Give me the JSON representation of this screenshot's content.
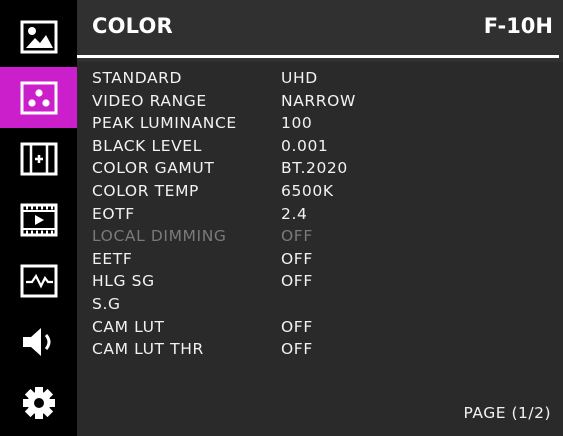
{
  "sidebar": {
    "items": [
      {
        "name": "picture",
        "icon": "picture-icon",
        "active": false
      },
      {
        "name": "color",
        "icon": "color-dots-icon",
        "active": true
      },
      {
        "name": "marker",
        "icon": "marker-icon",
        "active": false
      },
      {
        "name": "video",
        "icon": "film-play-icon",
        "active": false
      },
      {
        "name": "analysis",
        "icon": "waveform-icon",
        "active": false
      },
      {
        "name": "audio",
        "icon": "speaker-icon",
        "active": false
      },
      {
        "name": "system",
        "icon": "gear-icon",
        "active": false
      }
    ],
    "active_color": "#cc1fcc"
  },
  "header": {
    "title": "COLOR",
    "model": "F-10H"
  },
  "settings": [
    {
      "label": "STANDARD",
      "value": "UHD",
      "enabled": true
    },
    {
      "label": "VIDEO RANGE",
      "value": "NARROW",
      "enabled": true
    },
    {
      "label": "PEAK LUMINANCE",
      "value": "100",
      "enabled": true
    },
    {
      "label": "BLACK  LEVEL",
      "value": "0.001",
      "enabled": true
    },
    {
      "label": "COLOR  GAMUT",
      "value": "BT.2020",
      "enabled": true
    },
    {
      "label": "COLOR  TEMP",
      "value": "6500K",
      "enabled": true
    },
    {
      "label": "EOTF",
      "value": "2.4",
      "enabled": true
    },
    {
      "label": "LOCAL  DIMMING",
      "value": "OFF",
      "enabled": false
    },
    {
      "label": "EETF",
      "value": "OFF",
      "enabled": true
    },
    {
      "label": "HLG  SG",
      "value": "OFF",
      "enabled": true
    },
    {
      "label": "S.G",
      "value": "",
      "enabled": true
    },
    {
      "label": "CAM  LUT",
      "value": "OFF",
      "enabled": true
    },
    {
      "label": "CAM  LUT THR",
      "value": "OFF",
      "enabled": true
    }
  ],
  "footer": {
    "page": "PAGE (1/2)"
  }
}
